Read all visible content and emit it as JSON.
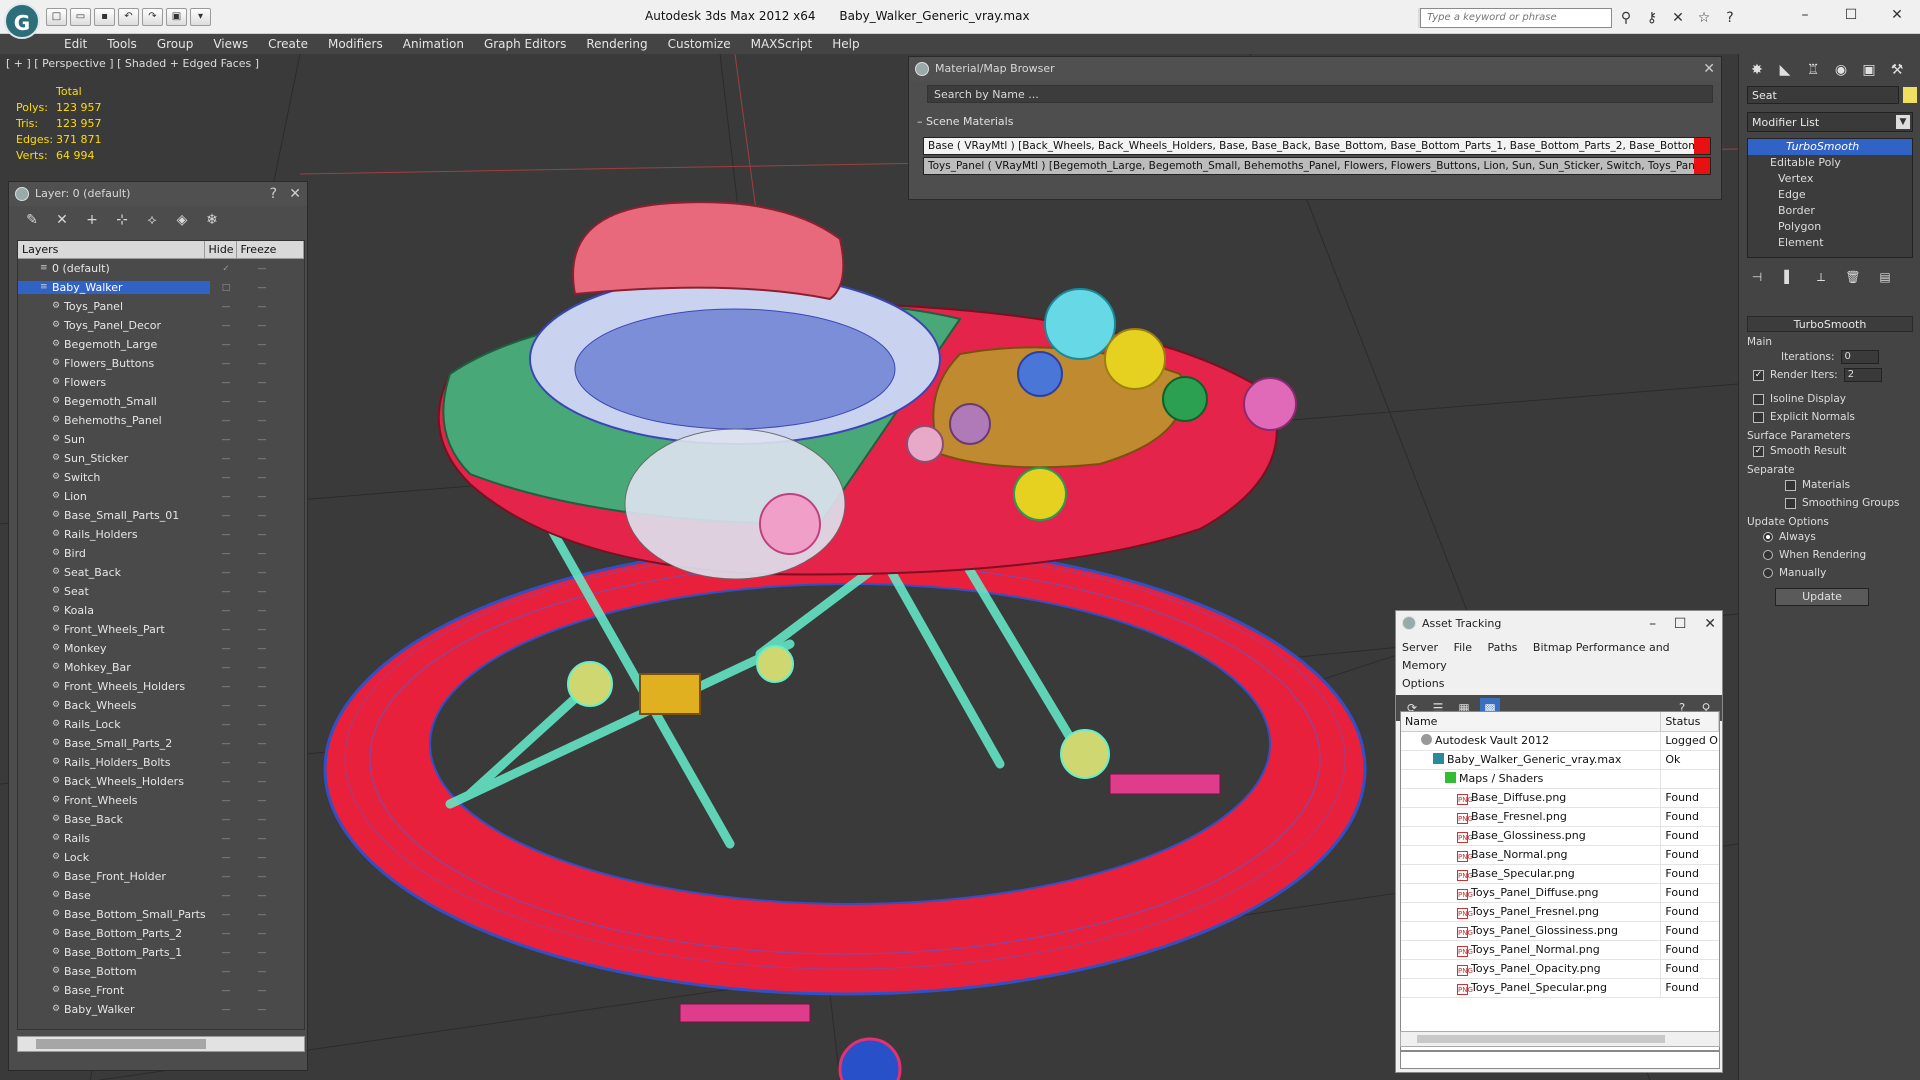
{
  "titlebar": {
    "app_title": "Autodesk 3ds Max  2012 x64",
    "file_name": "Baby_Walker_Generic_vray.max",
    "search_placeholder": "Type a keyword or phrase",
    "logo_letter": "G"
  },
  "menu": [
    "Edit",
    "Tools",
    "Group",
    "Views",
    "Create",
    "Modifiers",
    "Animation",
    "Graph Editors",
    "Rendering",
    "Customize",
    "MAXScript",
    "Help"
  ],
  "viewport": {
    "label": "[ + ] [ Perspective ] [ Shaded + Edged Faces ]",
    "stats": {
      "header": "Total",
      "rows": [
        {
          "key": "Polys:",
          "value": "123 957"
        },
        {
          "key": "Tris:",
          "value": "123 957"
        },
        {
          "key": "Edges:",
          "value": "371 871"
        },
        {
          "key": "Verts:",
          "value": "64 994"
        }
      ]
    }
  },
  "layer_window": {
    "title": "Layer: 0 (default)",
    "help": "?",
    "columns": {
      "layers": "Layers",
      "hide": "Hide",
      "freeze": "Freeze"
    },
    "default_layer": "0 (default)",
    "selected_layer": "Baby_Walker",
    "objects": [
      "Toys_Panel",
      "Toys_Panel_Decor",
      "Begemoth_Large",
      "Flowers_Buttons",
      "Flowers",
      "Begemoth_Small",
      "Behemoths_Panel",
      "Sun",
      "Sun_Sticker",
      "Switch",
      "Lion",
      "Base_Small_Parts_01",
      "Rails_Holders",
      "Bird",
      "Seat_Back",
      "Seat",
      "Koala",
      "Front_Wheels_Part",
      "Monkey",
      "Mohkey_Bar",
      "Front_Wheels_Holders",
      "Back_Wheels",
      "Rails_Lock",
      "Base_Small_Parts_2",
      "Rails_Holders_Bolts",
      "Back_Wheels_Holders",
      "Front_Wheels",
      "Base_Back",
      "Rails",
      "Lock",
      "Base_Front_Holder",
      "Base",
      "Base_Bottom_Small_Parts",
      "Base_Bottom_Parts_2",
      "Base_Bottom_Parts_1",
      "Base_Bottom",
      "Base_Front",
      "Baby_Walker"
    ]
  },
  "material_browser": {
    "title": "Material/Map Browser",
    "search": "Search by Name ...",
    "section": "Scene Materials",
    "rows": [
      "Base  ( VRayMtl )  [Back_Wheels, Back_Wheels_Holders, Base, Base_Back, Base_Bottom, Base_Bottom_Parts_1, Base_Bottom_Parts_2, Base_Bottom_...",
      "Toys_Panel  ( VRayMtl )  [Begemoth_Large, Begemoth_Small, Behemoths_Panel, Flowers, Flowers_Buttons, Lion, Sun, Sun_Sticker, Switch, Toys_Panel..."
    ]
  },
  "command_panel": {
    "object_name": "Seat",
    "modifier_list": "Modifier List",
    "stack": [
      {
        "label": "TurboSmooth",
        "type": "sel"
      },
      {
        "label": "Editable Poly",
        "type": "base"
      },
      {
        "label": "Vertex",
        "type": "sub"
      },
      {
        "label": "Edge",
        "type": "sub"
      },
      {
        "label": "Border",
        "type": "sub"
      },
      {
        "label": "Polygon",
        "type": "sub"
      },
      {
        "label": "Element",
        "type": "sub"
      }
    ],
    "turbosmooth": {
      "title": "TurboSmooth",
      "main": "Main",
      "iterations_label": "Iterations:",
      "iterations_value": "0",
      "render_iters_label": "Render Iters:",
      "render_iters_value": "2",
      "isoline": "Isoline Display",
      "explicit": "Explicit Normals",
      "surface_params": "Surface Parameters",
      "smooth_result": "Smooth Result",
      "separate": "Separate",
      "materials": "Materials",
      "smoothing_groups": "Smoothing Groups",
      "update_options": "Update Options",
      "always": "Always",
      "when_rendering": "When Rendering",
      "manually": "Manually",
      "update": "Update"
    }
  },
  "asset_tracking": {
    "title": "Asset Tracking",
    "menu_row1": [
      "Server",
      "File",
      "Paths",
      "Bitmap Performance and Memory"
    ],
    "menu_row2": [
      "Options"
    ],
    "columns": {
      "name": "Name",
      "status": "Status"
    },
    "rows": [
      {
        "name": "Autodesk Vault 2012",
        "status": "Logged O",
        "indent": 1,
        "icon": "vault"
      },
      {
        "name": "Baby_Walker_Generic_vray.max",
        "status": "Ok",
        "indent": 2,
        "icon": "max"
      },
      {
        "name": "Maps / Shaders",
        "status": "",
        "indent": 3,
        "icon": "folder"
      },
      {
        "name": "Base_Diffuse.png",
        "status": "Found",
        "indent": 4,
        "icon": "png"
      },
      {
        "name": "Base_Fresnel.png",
        "status": "Found",
        "indent": 4,
        "icon": "png"
      },
      {
        "name": "Base_Glossiness.png",
        "status": "Found",
        "indent": 4,
        "icon": "png"
      },
      {
        "name": "Base_Normal.png",
        "status": "Found",
        "indent": 4,
        "icon": "png"
      },
      {
        "name": "Base_Specular.png",
        "status": "Found",
        "indent": 4,
        "icon": "png"
      },
      {
        "name": "Toys_Panel_Diffuse.png",
        "status": "Found",
        "indent": 4,
        "icon": "png"
      },
      {
        "name": "Toys_Panel_Fresnel.png",
        "status": "Found",
        "indent": 4,
        "icon": "png"
      },
      {
        "name": "Toys_Panel_Glossiness.png",
        "status": "Found",
        "indent": 4,
        "icon": "png"
      },
      {
        "name": "Toys_Panel_Normal.png",
        "status": "Found",
        "indent": 4,
        "icon": "png"
      },
      {
        "name": "Toys_Panel_Opacity.png",
        "status": "Found",
        "indent": 4,
        "icon": "png"
      },
      {
        "name": "Toys_Panel_Specular.png",
        "status": "Found",
        "indent": 4,
        "icon": "png"
      }
    ]
  }
}
